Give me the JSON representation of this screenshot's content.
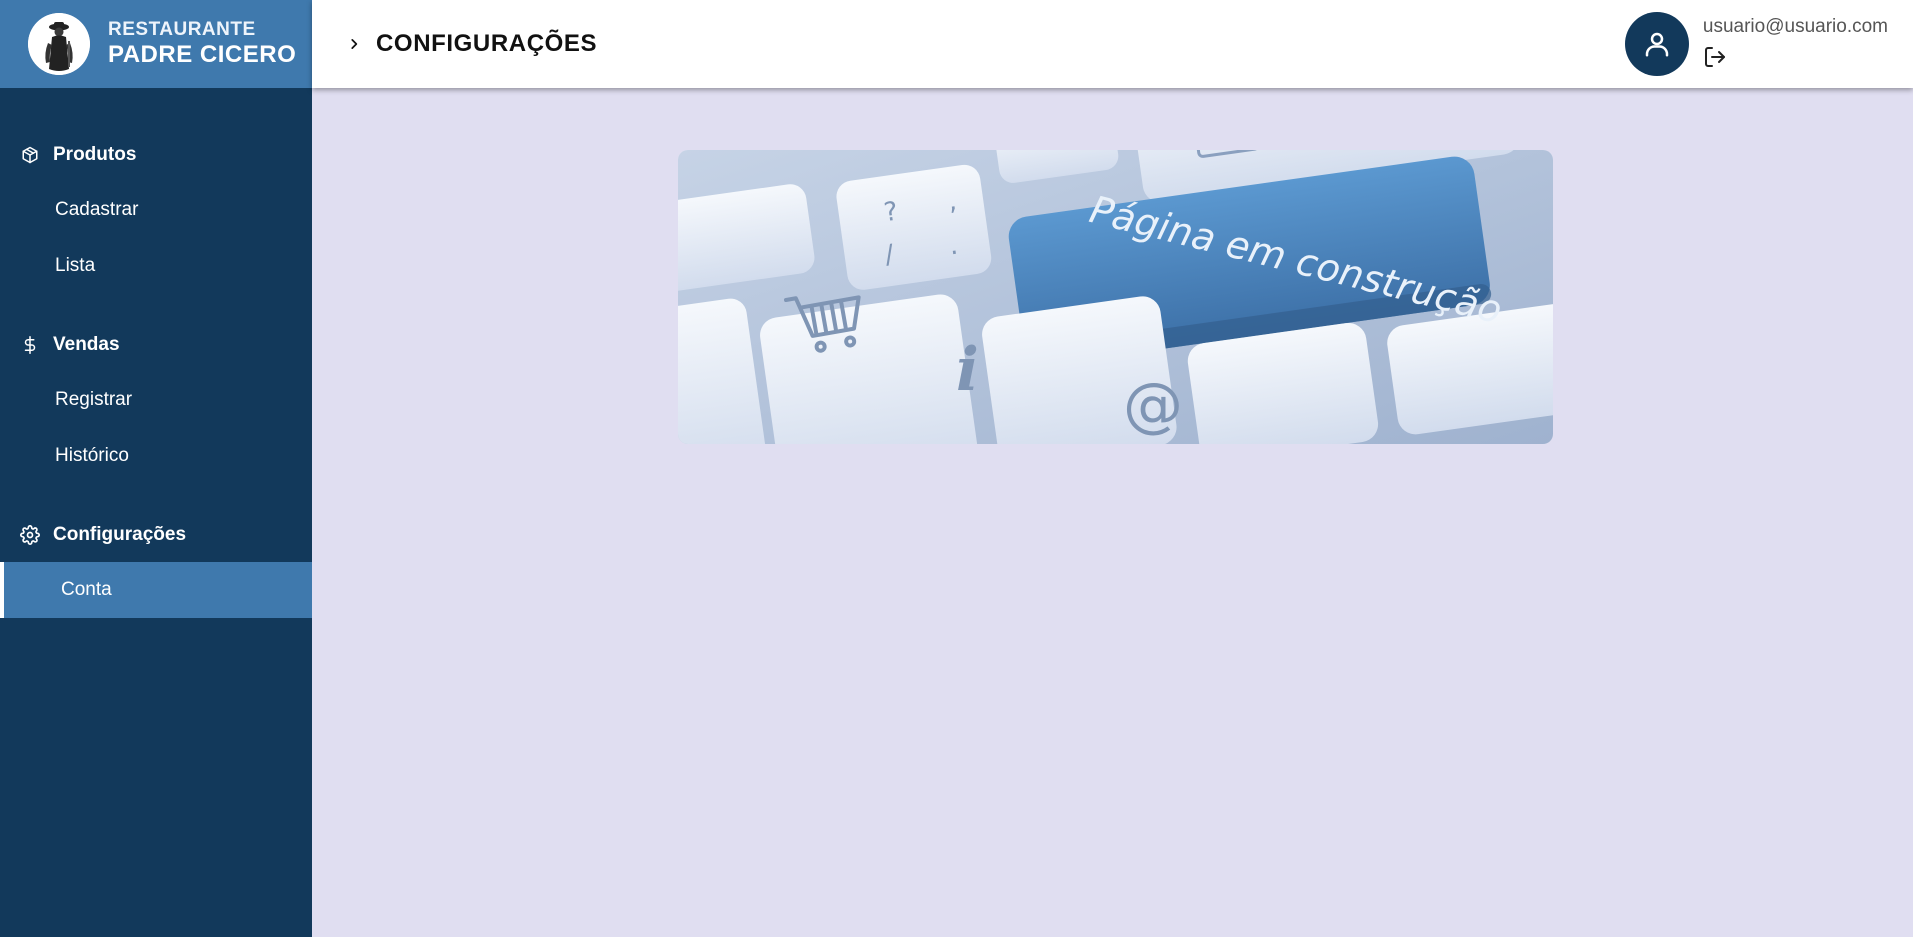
{
  "brand": {
    "line1": "RESTAURANTE",
    "line2": "PADRE CICERO",
    "logo_icon": "priest-silhouette-icon"
  },
  "sidebar": {
    "groups": [
      {
        "label": "Produtos",
        "icon": "box-icon",
        "items": [
          {
            "label": "Cadastrar",
            "active": false
          },
          {
            "label": "Lista",
            "active": false
          }
        ]
      },
      {
        "label": "Vendas",
        "icon": "dollar-icon",
        "items": [
          {
            "label": "Registrar",
            "active": false
          },
          {
            "label": "Histórico",
            "active": false
          }
        ]
      },
      {
        "label": "Configurações",
        "icon": "gear-icon",
        "items": [
          {
            "label": "Conta",
            "active": true
          }
        ]
      }
    ]
  },
  "header": {
    "title": "CONFIGURAÇÕES",
    "breadcrumb_icon": "chevron-right-icon",
    "user_email": "usuario@usuario.com",
    "avatar_icon": "user-icon",
    "logout_icon": "logout-icon"
  },
  "main": {
    "banner_text": "Página em construção",
    "banner_icons": [
      "shopping-cart-icon",
      "info-icon",
      "at-sign-icon"
    ]
  },
  "colors": {
    "sidebar_bg": "#12395b",
    "accent": "#3f79ad",
    "content_bg": "#e0def1",
    "key_blue": "#4a86c0"
  }
}
